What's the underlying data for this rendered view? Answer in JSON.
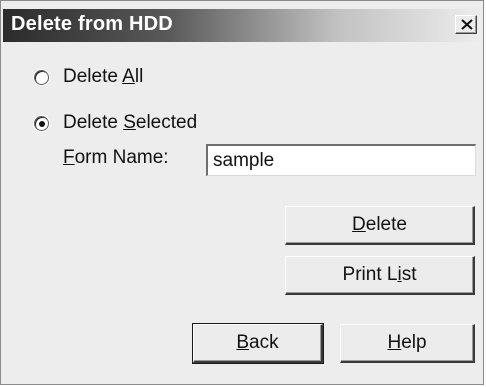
{
  "dialog": {
    "title": "Delete from HDD",
    "close_glyph": "X"
  },
  "options": {
    "delete_all": {
      "label_pre": "Delete ",
      "label_key": "A",
      "label_post": "ll",
      "selected": false
    },
    "delete_selected": {
      "label_pre": "Delete ",
      "label_key": "S",
      "label_post": "elected",
      "selected": true
    }
  },
  "form_name": {
    "label_key": "F",
    "label_post": "orm Name:",
    "value": "sample"
  },
  "buttons": {
    "delete": {
      "key": "D",
      "rest": "elete"
    },
    "print_list": {
      "pre": "Print L",
      "key": "i",
      "rest": "st"
    },
    "back": {
      "key": "B",
      "rest": "ack"
    },
    "help": {
      "key": "H",
      "rest": "elp"
    }
  }
}
